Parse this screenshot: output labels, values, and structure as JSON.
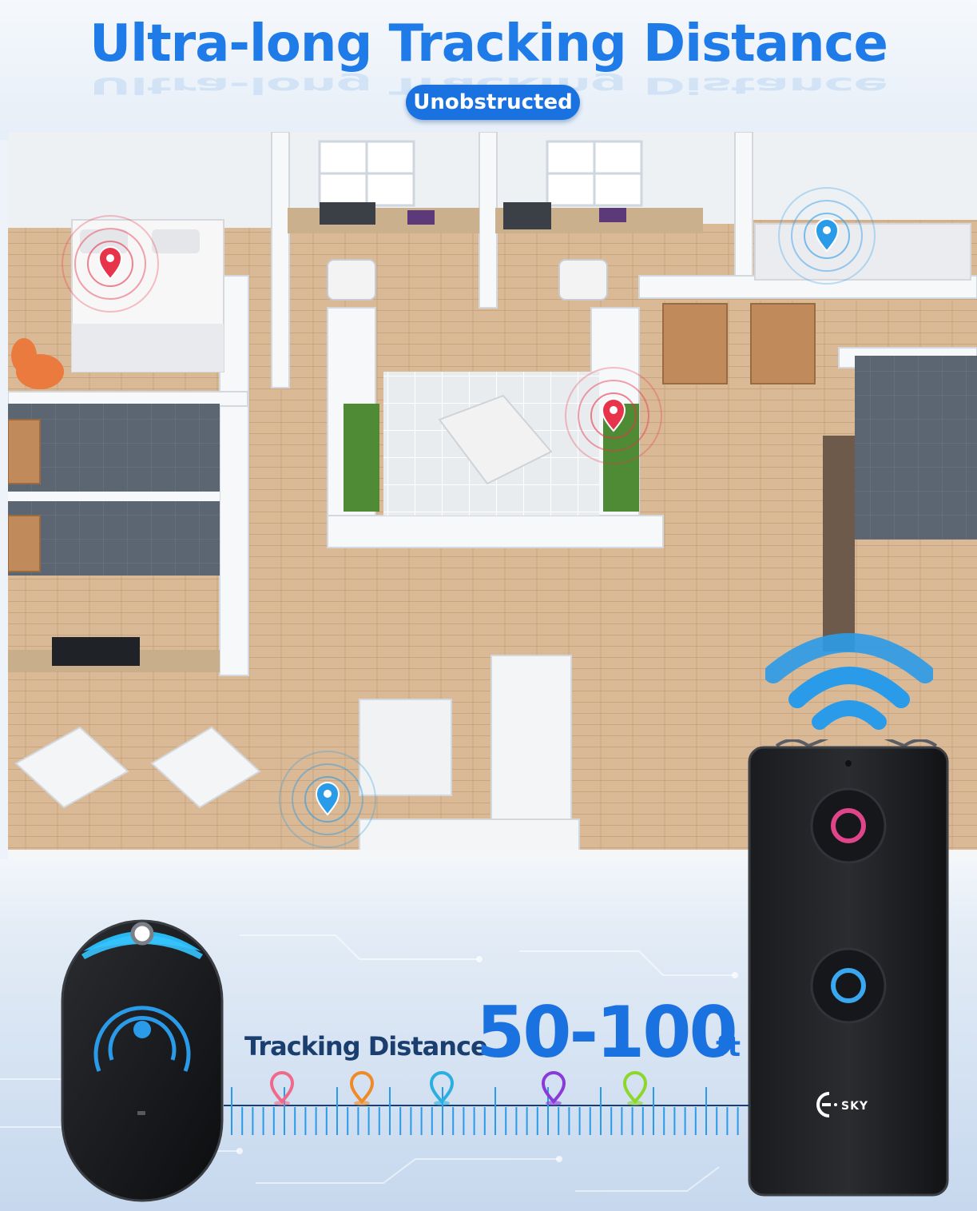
{
  "header": {
    "title": "Ultra-long Tracking Distance",
    "badge": "Unobstructed"
  },
  "tracking": {
    "label": "Tracking Distance",
    "value": "50-100",
    "unit": "ft"
  },
  "brand": {
    "logo_text": "SKY"
  },
  "colors": {
    "accent": "#1a72e0",
    "dark_text": "#1a3e6e",
    "ping_red": "#e8344a",
    "ping_blue": "#2a9be8",
    "marker_pink": "#ef6a8a",
    "marker_orange": "#f08a24",
    "marker_cyan": "#2ab0e0",
    "marker_purple": "#8a3ad8",
    "marker_lime": "#8ed62a"
  },
  "icons": [
    "location-pin-icon",
    "signal-ring-icon",
    "wifi-signal-icon",
    "key-ring-icon"
  ]
}
